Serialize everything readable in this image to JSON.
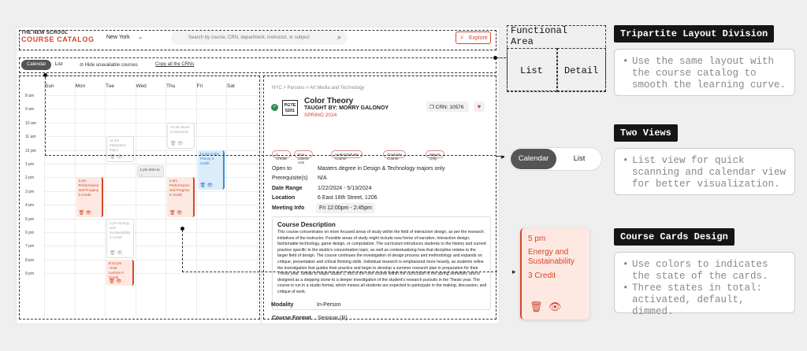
{
  "header": {
    "brand_top": "THE NEW SCHOOL",
    "brand_main": "COURSE CATALOG",
    "city": "New York",
    "search_placeholder": "Search by course, CRN, department, instructor, or subject",
    "explore_label": "Explore"
  },
  "toolbar": {
    "views": [
      "Calendar",
      "List"
    ],
    "hide_label": "Hide unavailable courses",
    "copy_label": "Copy all the CRNs"
  },
  "calendar": {
    "days": [
      "Sun",
      "Mon",
      "Tue",
      "Wed",
      "Thu",
      "Fri",
      "Sat"
    ],
    "times": [
      "8 am",
      "9 am",
      "10 am",
      "11 am",
      "12 pm",
      "1 pm",
      "2 pm",
      "3 pm",
      "4 pm",
      "5 pm",
      "6 pm",
      "7 pm",
      "8 pm",
      "9 pm"
    ],
    "cards": [
      {
        "text": "11 am Integrated Major",
        "state": "dim"
      },
      {
        "text": "10 am Move to Narrative",
        "state": "dim"
      },
      {
        "text": "12 pm Color Theory 3 Credit",
        "state": "blue"
      },
      {
        "text": "1 pm Intro to ...",
        "state": "default"
      },
      {
        "text": "2 pm Performance and Progeny 6 Credit",
        "state": "active"
      },
      {
        "text": "2 pm Performance and Progeny 6 Credit",
        "state": "active"
      },
      {
        "text": "5 pm Energy and Sustainability 3 Credit",
        "state": "dim"
      },
      {
        "text": "8:10 pm +Fab Lecture 0 Credit",
        "state": "active"
      }
    ]
  },
  "detail": {
    "breadcrumb": "NYC  >  Parsons  >  Art Media and Technology",
    "course_code_1": "PGTE",
    "course_code_2": "5201",
    "title": "Color Theory",
    "taught_by": "TAUGHT BY: MORRY GALONOY",
    "term": "SPRING 2024",
    "crn": "CRN: 10576",
    "tags": [
      "3 Credits",
      "Non-Liberal Arts",
      "Undergraduate Course",
      "Graduate Course",
      "Majors Only"
    ],
    "open_to_label": "Open to",
    "open_to_value": "Masters degree in Design & Technology majors only",
    "prereq_label": "Prerequisite(s)",
    "prereq_value": "N/A",
    "date_label": "Date Range",
    "date_value": "1/22/2024 - 5/13/2024",
    "location_label": "Location",
    "location_value": "6 East 16th Street, 1206",
    "meeting_label": "Meeting Info",
    "meeting_value": "Fri 12:00pm - 2:45pm",
    "desc_title": "Course Description",
    "desc_text": "This course concentrates on more focused areas of study within the field of interaction design, as per the research initiatives of the instructor. Possible areas of study might include new forms of narrative, interaction design, fashionable technology, game design, or computation. The curriculum introduces students to the history and current practice specific to the studio's concentration topic, as well as contextualizing how that discipline relates to the larger field of design. The course continues the investigation of design process and methodology and expands on critique, presentation and critical thinking skills. Individual research is emphasized more heavily, as students refine the investigation that guides their practice and begin to develop a summer research plan in preparation for their Thesis year. Similar to Major Studio 1, this is the core course within the curriculum in the spring semester, and is designed as a stepping stone to a deeper investigation of the student's research pursuits in the Thesis year. The course is run in a studio format, which means all students are expected to participate in the making, discussion, and critique of work.",
    "format_label": "Course Format",
    "format_value": "Seminar (R)",
    "modality_label": "Modality",
    "modality_value": "In-Person"
  },
  "annotations": {
    "functional_area": "Functional Area",
    "list": "List",
    "detail": "Detail",
    "h1": "Tripartite Layout Division",
    "n1": "Use the same layout with the course catalog to smooth the learning curve.",
    "h2": "Two Views",
    "toggle": [
      "Calendar",
      "List"
    ],
    "n2": "List view for quick scanning and calendar view for better visualization.",
    "h3": "Course Cards Design",
    "big_card_time": "5 pm",
    "big_card_title": "Energy and Sustainability",
    "big_card_credit": "3 Credit",
    "n3a": "Use colors to indicates the state of the cards.",
    "n3b": "Three states in total: activated, default, dimmed."
  },
  "colors": {
    "accent": "#d6442a",
    "blue": "#3b8bd6",
    "active_bg": "#fde9e1"
  }
}
